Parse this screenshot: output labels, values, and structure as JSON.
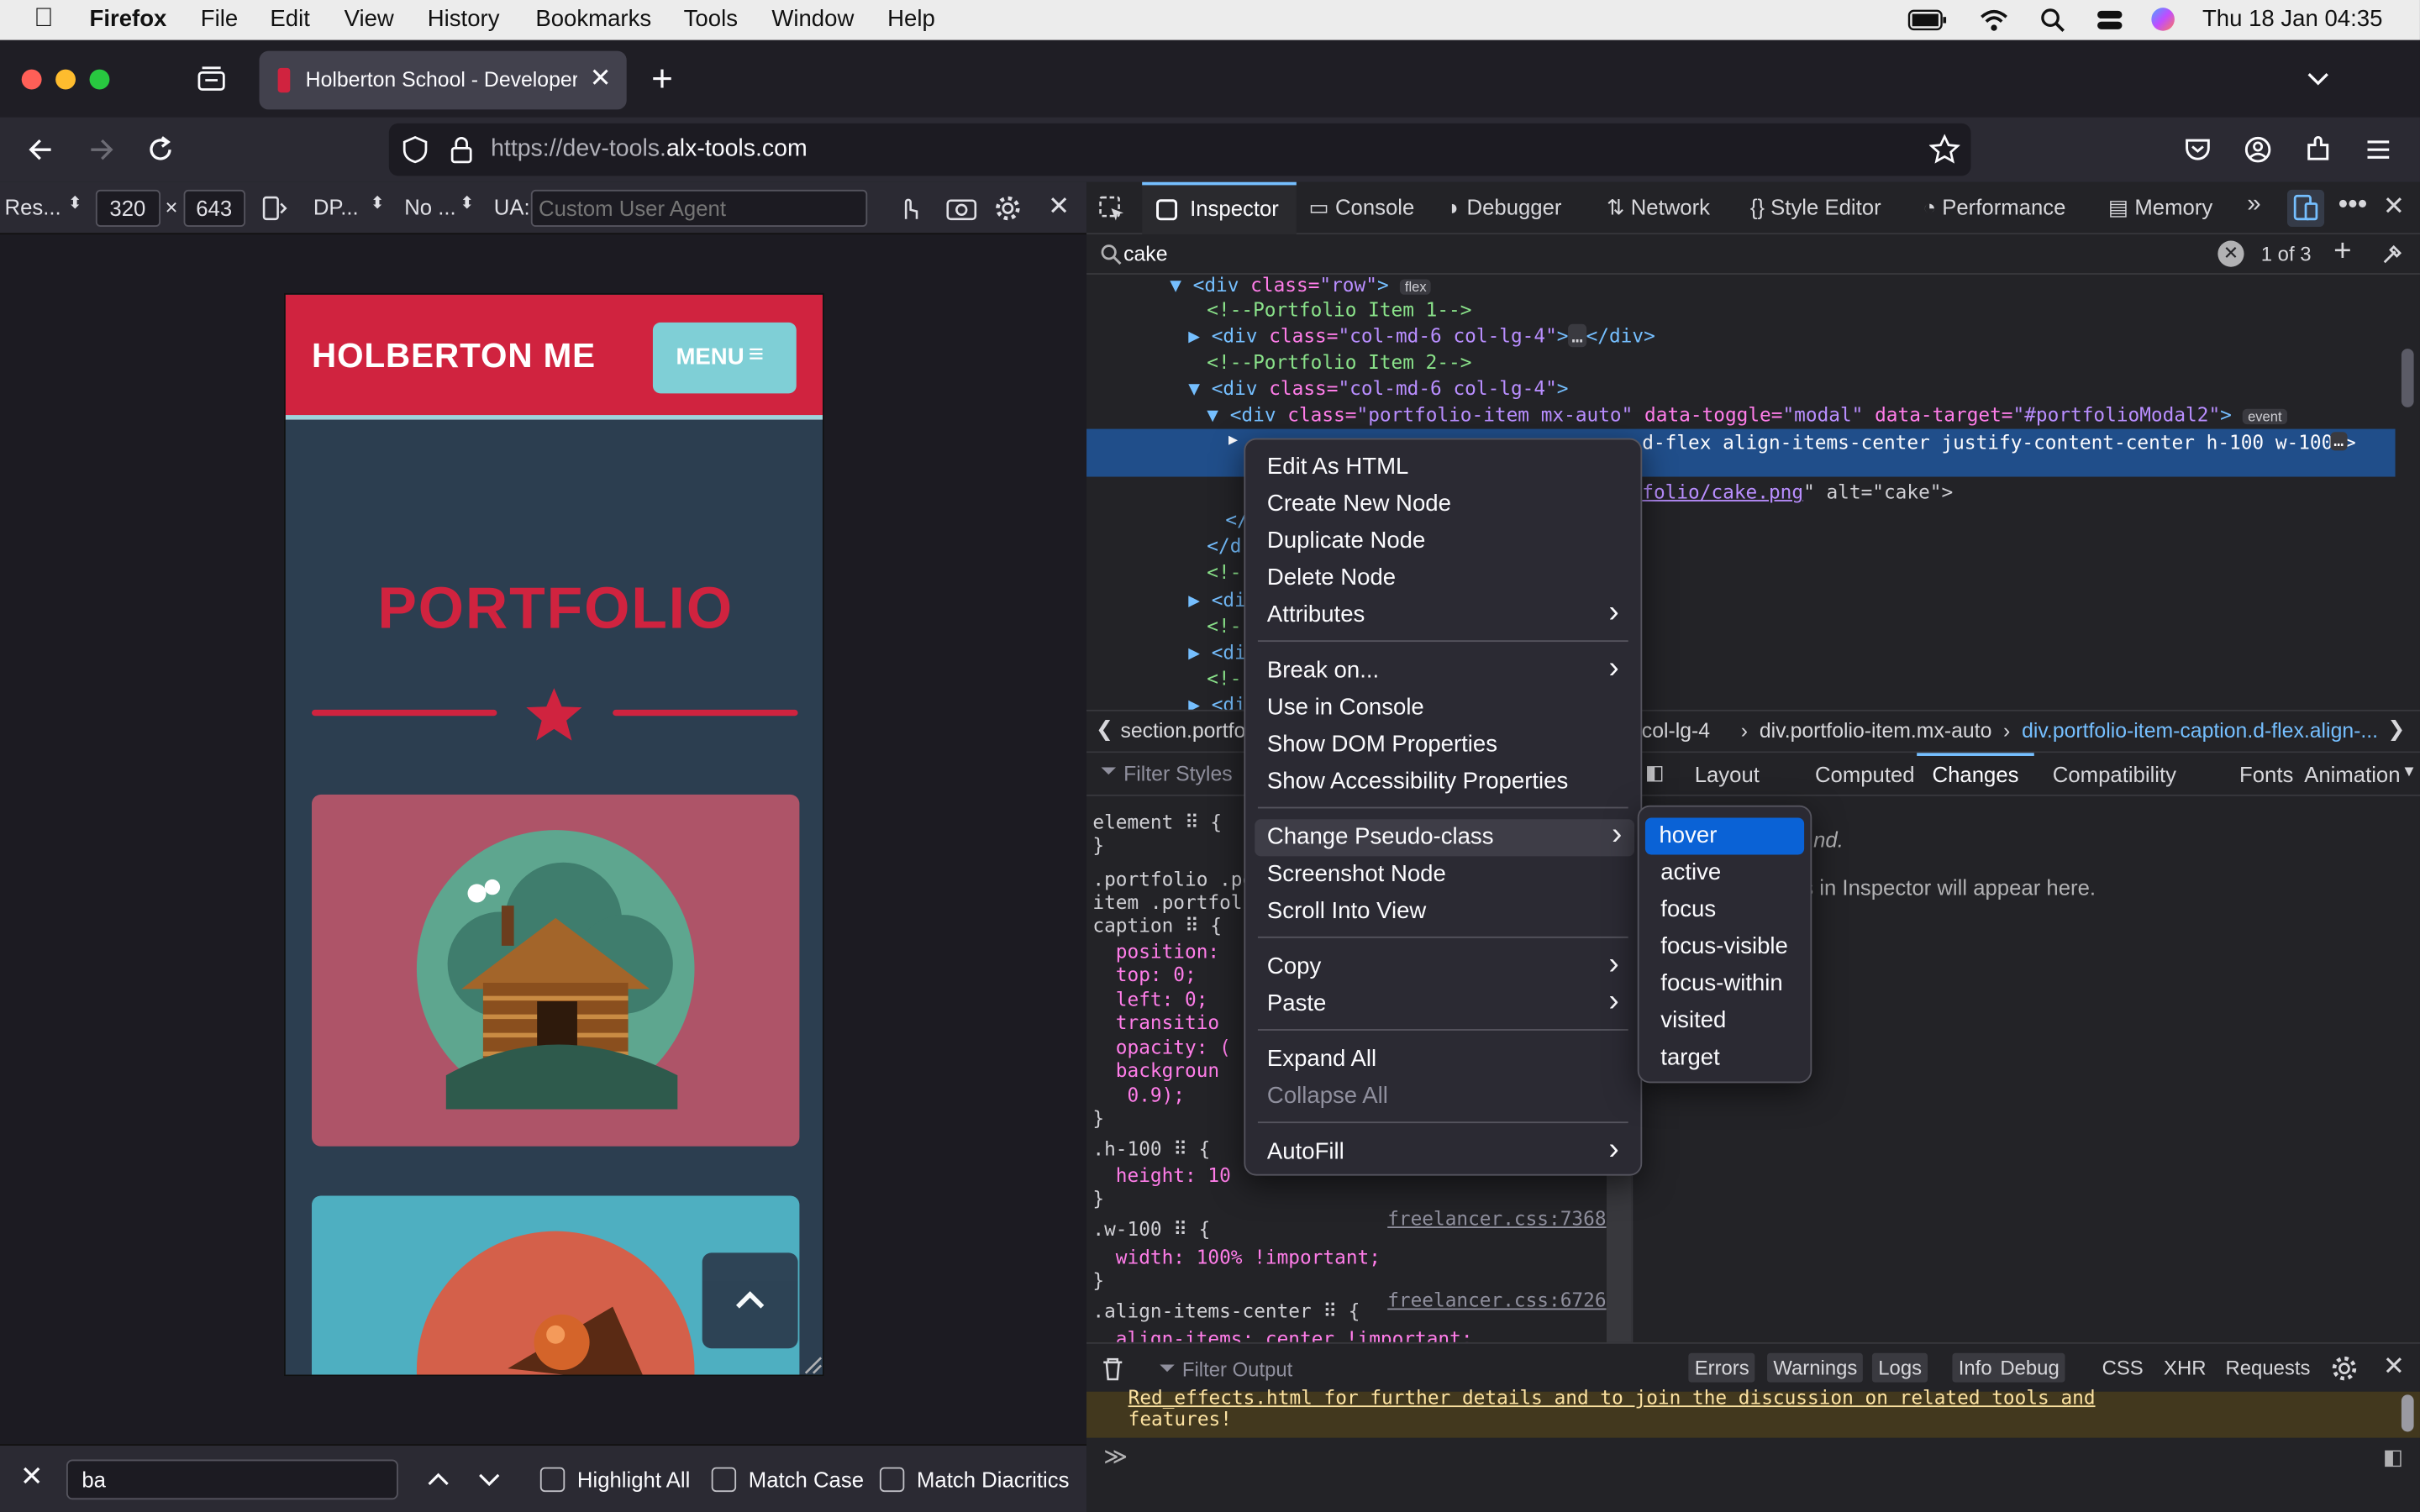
{
  "menubar": {
    "app": "Firefox",
    "items": [
      "File",
      "Edit",
      "View",
      "History",
      "Bookmarks",
      "Tools",
      "Window",
      "Help"
    ],
    "clock": "Thu 18 Jan  04:35"
  },
  "tab": {
    "title": "Holberton School - Developer to"
  },
  "url": {
    "prefix": "https://dev-tools.",
    "domain": "alx-tools.com"
  },
  "rdm": {
    "device": "Res...",
    "width": "320",
    "x": "×",
    "height": "643",
    "dpr": "DP...",
    "throttle": "No ...",
    "ua_label": "UA:",
    "ua_placeholder": "Custom User Agent"
  },
  "devtools": {
    "tabs": [
      "Inspector",
      "Console",
      "Debugger",
      "Network",
      "Style Editor",
      "Performance",
      "Memory"
    ],
    "search_value": "cake",
    "search_count": "1 of 3"
  },
  "markup": {
    "lines": [
      {
        "pre": "▼",
        "tag": "<div ",
        "attr": "class=",
        "val": "\"row\"",
        "end": ">",
        "badge": "flex"
      },
      {
        "comment": "<!--Portfolio Item 1-->"
      },
      {
        "pre": "▶",
        "tag": "<div ",
        "attr": "class=",
        "val": "\"col-md-6 col-lg-4\"",
        "end": ">",
        "dots": "…",
        "close": "</div>"
      },
      {
        "comment": "<!--Portfolio Item 2-->"
      },
      {
        "pre": "▼",
        "tag": "<div ",
        "attr": "class=",
        "val": "\"col-md-6 col-lg-4\"",
        "end": ">"
      },
      {
        "pre": "▼",
        "tag": "<div ",
        "attr": "class=",
        "val": "\"portfolio-item mx-auto\"",
        "attr2": " data-toggle=",
        "val2": "\"modal\"",
        "attr3": " data-target=",
        "val3": "\"#portfolioModal2\"",
        "end": ">",
        "badge": "event"
      },
      {
        "selected_text": "d-flex align-items-center justify-content-center h-100 w-100\">"
      },
      {
        "img_text": "folio/cake.png",
        "img_alt": "\" alt=\"cake\">"
      }
    ],
    "short_lines": [
      "</d",
      "</d",
      "<!--",
      "<div",
      "<!--",
      "<div",
      "<!--",
      "<div"
    ]
  },
  "breadcrumb": {
    "first": "section.portfolio",
    "middle": ".col-lg-4",
    "item": "div.portfolio-item.mx-auto",
    "last": "div.portfolio-item-caption.d-flex.align-..."
  },
  "rules": {
    "filter_placeholder": "Filter Styles",
    "lines": [
      "element ⠿ {",
      "}",
      ".portfolio .po",
      "item .portfoli",
      "caption ⠿ {",
      "  position:",
      "  top: 0;",
      "  left: 0;",
      "  transitio",
      "  opacity: (",
      "  backgroun",
      "   0.9);",
      "}",
      ".h-100 ⠿ {",
      "  height: 10",
      "}",
      ".w-100 ⠿ {",
      "  width: 100% !important;",
      "}",
      ".align-items-center ⠿ {",
      "  align-items: center !important;"
    ],
    "src1": "freelancer.css:7368",
    "src2": "freelancer.css:6726"
  },
  "side": {
    "tabs": [
      "Layout",
      "Computed",
      "Changes",
      "Compatibility",
      "Fonts",
      "Animation"
    ],
    "frag1": "nd.",
    "frag2": "s in Inspector will appear here."
  },
  "console": {
    "filter_placeholder": "Filter Output",
    "filters": [
      "Errors",
      "Warnings",
      "Logs",
      "Info",
      "Debug"
    ],
    "extras": [
      "CSS",
      "XHR",
      "Requests"
    ],
    "msg1": "Red_effects.html for further details and to join the discussion on related tools and",
    "msg2": "features!"
  },
  "findbar": {
    "value": "ba",
    "opts": [
      "Highlight All",
      "Match Case",
      "Match Diacritics"
    ]
  },
  "site": {
    "brand": "HOLBERTON ME",
    "menu": "MENU",
    "heading": "PORTFOLIO"
  },
  "context_menu": {
    "items": [
      "Edit As HTML",
      "Create New Node",
      "Duplicate Node",
      "Delete Node",
      "Attributes",
      "Break on...",
      "Use in Console",
      "Show DOM Properties",
      "Show Accessibility Properties",
      "Change Pseudo-class",
      "Screenshot Node",
      "Scroll Into View",
      "Copy",
      "Paste",
      "Expand All",
      "Collapse All",
      "AutoFill"
    ]
  },
  "submenu": {
    "items": [
      "hover",
      "active",
      "focus",
      "focus-visible",
      "focus-within",
      "visited",
      "target"
    ]
  },
  "colors": {
    "brand_red": "#d0233f",
    "teal": "#2c3e50",
    "menu_btn": "#7fcfd6",
    "highlight": "#0a62d6",
    "selection": "#204e8a"
  }
}
